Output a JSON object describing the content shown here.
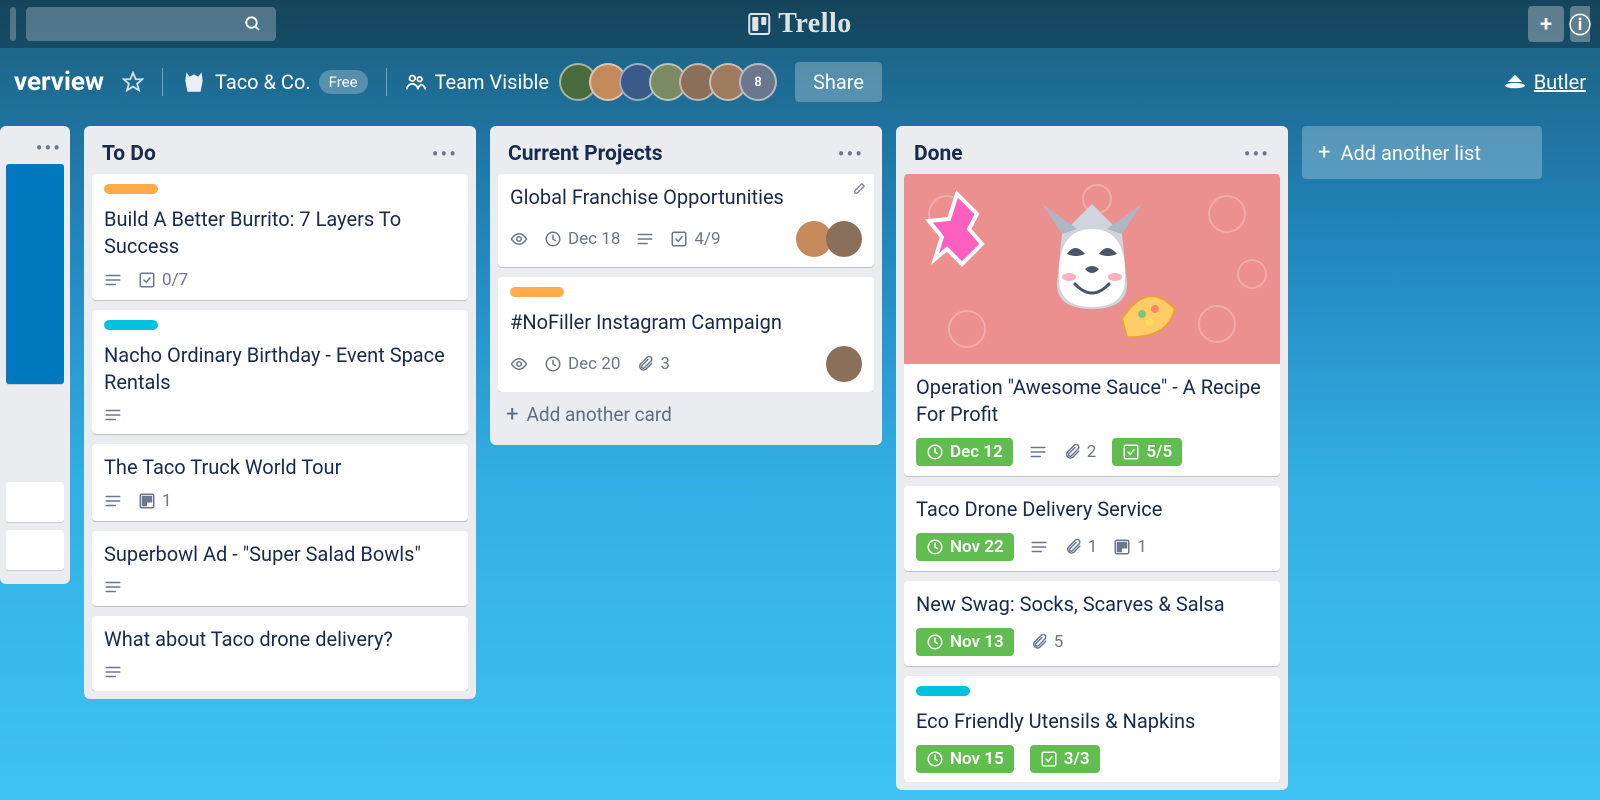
{
  "header": {
    "app_name": "Trello",
    "plus": "+",
    "info": "ⓘ"
  },
  "board_header": {
    "name": "verview",
    "star_icon": "star",
    "team_name": "Taco & Co.",
    "plan_label": "Free",
    "visibility": "Team Visible",
    "avatar_overflow": "8",
    "share_label": "Share",
    "butler_label": "Butler"
  },
  "avatar_colors": [
    "#4a6b3d",
    "#c48a5c",
    "#3a5a8a",
    "#7a8a62",
    "#8a6f5a",
    "#9e7a5f"
  ],
  "lists": [
    {
      "title": "To Do",
      "cards": [
        {
          "labels": [
            "orange"
          ],
          "title": "Build A Better Burrito: 7 Layers To Success",
          "badges": [
            {
              "type": "desc"
            },
            {
              "type": "check",
              "text": "0/7"
            }
          ]
        },
        {
          "labels": [
            "sky"
          ],
          "title": "Nacho Ordinary Birthday - Event Space Rentals",
          "badges": [
            {
              "type": "desc"
            }
          ]
        },
        {
          "title": "The Taco Truck World Tour",
          "badges": [
            {
              "type": "desc"
            },
            {
              "type": "trello",
              "text": "1"
            }
          ]
        },
        {
          "title": "Superbowl Ad - \"Super Salad Bowls\"",
          "badges": [
            {
              "type": "desc"
            }
          ]
        },
        {
          "title": "What about Taco drone delivery?",
          "badges": [
            {
              "type": "desc"
            }
          ]
        }
      ]
    },
    {
      "title": "Current Projects",
      "cards": [
        {
          "title": "Global Franchise Opportunities",
          "edit": true,
          "badges": [
            {
              "type": "eye"
            },
            {
              "type": "due",
              "text": "Dec 18"
            },
            {
              "type": "desc"
            },
            {
              "type": "check",
              "text": "4/9"
            }
          ],
          "members": [
            "#c48a5c",
            "#8a6f5a"
          ]
        },
        {
          "labels": [
            "orange"
          ],
          "title": "#NoFiller Instagram Campaign",
          "badges": [
            {
              "type": "eye"
            },
            {
              "type": "due",
              "text": "Dec 20"
            },
            {
              "type": "attach",
              "text": "3"
            }
          ],
          "members": [
            "#8a6f5a"
          ]
        }
      ],
      "add_card_label": "Add another card"
    },
    {
      "title": "Done",
      "cards": [
        {
          "cover": true,
          "title": "Operation \"Awesome Sauce\" - A Recipe For Profit",
          "badges": [
            {
              "type": "due-green",
              "text": "Dec 12"
            },
            {
              "type": "desc"
            },
            {
              "type": "attach",
              "text": "2"
            },
            {
              "type": "check-green",
              "text": "5/5"
            }
          ]
        },
        {
          "title": "Taco Drone Delivery Service",
          "badges": [
            {
              "type": "due-green",
              "text": "Nov 22"
            },
            {
              "type": "desc"
            },
            {
              "type": "attach",
              "text": "1"
            },
            {
              "type": "trello",
              "text": "1"
            }
          ]
        },
        {
          "title": "New Swag: Socks, Scarves & Salsa",
          "badges": [
            {
              "type": "due-green",
              "text": "Nov 13"
            },
            {
              "type": "attach",
              "text": "5"
            }
          ]
        },
        {
          "labels": [
            "sky"
          ],
          "title": "Eco Friendly Utensils & Napkins",
          "badges": [
            {
              "type": "due-green",
              "text": "Nov 15"
            },
            {
              "type": "check-green",
              "text": "3/3"
            }
          ]
        }
      ]
    }
  ],
  "add_list_label": "Add another list"
}
